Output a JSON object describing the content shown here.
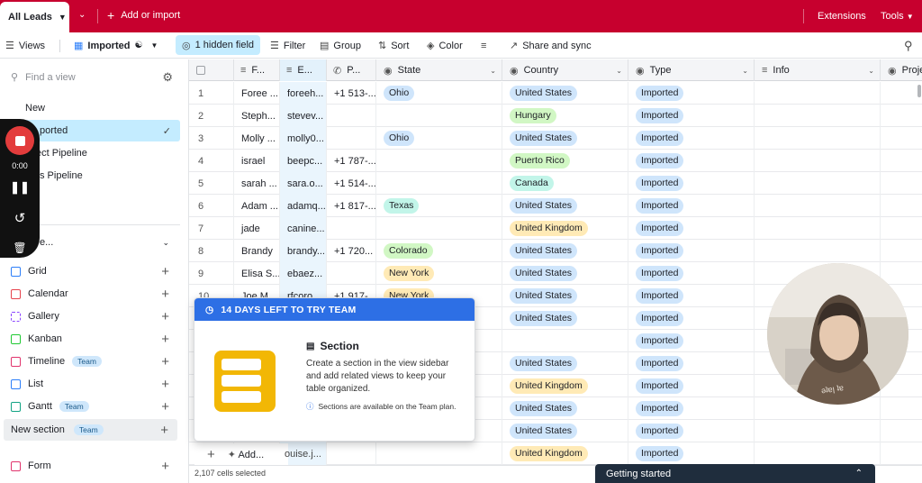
{
  "topbar": {
    "active_tab": "All Leads",
    "add_import": "Add or import",
    "extensions": "Extensions",
    "tools": "Tools"
  },
  "toolbar": {
    "views": "Views",
    "current_view": "Imported",
    "hidden_field": "1 hidden field",
    "filter": "Filter",
    "group": "Group",
    "sort": "Sort",
    "color": "Color",
    "share": "Share and sync"
  },
  "sidebar": {
    "find_placeholder": "Find a view",
    "views": [
      {
        "label": "New"
      },
      {
        "label": "ported"
      },
      {
        "label": "ect Pipeline"
      },
      {
        "label": "s Pipeline"
      }
    ],
    "create_header": "e...",
    "create_items": [
      {
        "label": "Grid",
        "color": "#2d7ff9"
      },
      {
        "label": "Calendar",
        "color": "#e6434d"
      },
      {
        "label": "Gallery",
        "color": "#8b46ff"
      },
      {
        "label": "Kanban",
        "color": "#20c933"
      },
      {
        "label": "Timeline",
        "color": "#e1346d",
        "badge": "Team"
      },
      {
        "label": "List",
        "color": "#2d7ff9"
      },
      {
        "label": "Gantt",
        "color": "#11a384",
        "badge": "Team"
      }
    ],
    "new_section": "New section",
    "new_section_badge": "Team",
    "form": "Form"
  },
  "recorder": {
    "time": "0:00"
  },
  "grid": {
    "columns": [
      "F...",
      "E...",
      "P...",
      "State",
      "Country",
      "Type",
      "Info",
      "Proje"
    ],
    "rows": [
      {
        "n": "1",
        "first": "Foree ...",
        "email": "foreeh...",
        "phone": "+1 513-...",
        "state": "Ohio",
        "state_cls": "",
        "country": "United States",
        "country_cls": "country-us",
        "type": "Imported"
      },
      {
        "n": "2",
        "first": "Steph...",
        "email": "stevev...",
        "phone": "",
        "state": "",
        "state_cls": "",
        "country": "Hungary",
        "country_cls": "country-hu",
        "type": "Imported"
      },
      {
        "n": "3",
        "first": "Molly ...",
        "email": "molly0...",
        "phone": "",
        "state": "Ohio",
        "state_cls": "",
        "country": "United States",
        "country_cls": "country-us",
        "type": "Imported"
      },
      {
        "n": "4",
        "first": "israel",
        "email": "beepc...",
        "phone": "+1 787-...",
        "state": "",
        "state_cls": "",
        "country": "Puerto Rico",
        "country_cls": "country-pr",
        "type": "Imported"
      },
      {
        "n": "5",
        "first": "sarah ...",
        "email": "sara.o...",
        "phone": "+1 514-...",
        "state": "",
        "state_cls": "",
        "country": "Canada",
        "country_cls": "country-ca",
        "type": "Imported"
      },
      {
        "n": "6",
        "first": "Adam ...",
        "email": "adamq...",
        "phone": "+1 817-...",
        "state": "Texas",
        "state_cls": "tx",
        "country": "United States",
        "country_cls": "country-us",
        "type": "Imported"
      },
      {
        "n": "7",
        "first": "jade",
        "email": "canine...",
        "phone": "",
        "state": "",
        "state_cls": "",
        "country": "United Kingdom",
        "country_cls": "country-uk",
        "type": "Imported"
      },
      {
        "n": "8",
        "first": "Brandy",
        "email": "brandy...",
        "phone": "+1 720...",
        "state": "Colorado",
        "state_cls": "co",
        "country": "United States",
        "country_cls": "country-us",
        "type": "Imported"
      },
      {
        "n": "9",
        "first": "Elisa S...",
        "email": "ebaez...",
        "phone": "",
        "state": "New York",
        "state_cls": "ny",
        "country": "United States",
        "country_cls": "country-us",
        "type": "Imported"
      },
      {
        "n": "10",
        "first": "Joe M...",
        "email": "rfcoro...",
        "phone": "+1 917-...",
        "state": "New York",
        "state_cls": "ny",
        "country": "United States",
        "country_cls": "country-us",
        "type": "Imported"
      },
      {
        "n": "",
        "first": "",
        "email": "",
        "phone": "",
        "state": "",
        "state_cls": "",
        "country": "United States",
        "country_cls": "country-us",
        "type": "Imported"
      },
      {
        "n": "",
        "first": "",
        "email": "",
        "phone": "",
        "state": "",
        "state_cls": "",
        "country": "",
        "country_cls": "",
        "type": "Imported"
      },
      {
        "n": "",
        "first": "",
        "email": "",
        "phone": "",
        "state": "",
        "state_cls": "",
        "country": "United States",
        "country_cls": "country-us",
        "type": "Imported"
      },
      {
        "n": "",
        "first": "",
        "email": "",
        "phone": "",
        "state": "",
        "state_cls": "",
        "country": "United Kingdom",
        "country_cls": "country-uk",
        "type": "Imported"
      },
      {
        "n": "",
        "first": "",
        "email": "",
        "phone": "",
        "state": "",
        "state_cls": "",
        "country": "United States",
        "country_cls": "country-us",
        "type": "Imported"
      },
      {
        "n": "",
        "first": "",
        "email": "",
        "phone": "",
        "state": "",
        "state_cls": "",
        "country": "United States",
        "country_cls": "country-us",
        "type": "Imported"
      },
      {
        "n": "",
        "first": "",
        "email": "",
        "phone": "",
        "state": "",
        "state_cls": "",
        "country": "United Kingdom",
        "country_cls": "country-uk",
        "type": "Imported"
      }
    ],
    "add_label": "Add...",
    "partial_email": "ouise.j...",
    "cells_selected": "2,107 cells selected"
  },
  "popup": {
    "header": "14 DAYS LEFT TO TRY TEAM",
    "title": "Section",
    "description": "Create a section in the view sidebar and add related views to keep your table organized.",
    "note": "Sections are available on the Team plan."
  },
  "getting_started": "Getting started",
  "colors": {
    "topbar": "#c7002e",
    "selected_view": "#c4ecff",
    "popup_header": "#2d6fe5",
    "popup_illustration": "#f2b705"
  }
}
